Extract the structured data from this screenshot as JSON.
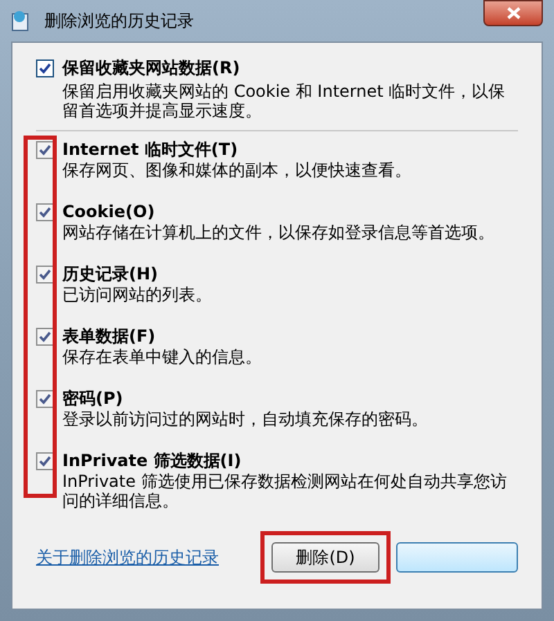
{
  "window": {
    "title": "删除浏览的历史记录"
  },
  "preserve_favorites": {
    "label": "保留收藏夹网站数据(R)",
    "checked": true,
    "description": "保留启用收藏夹网站的 Cookie 和 Internet 临时文件，以保留首选项并提高显示速度。"
  },
  "items": [
    {
      "label": "Internet 临时文件(T)",
      "checked": true,
      "description": "保存网页、图像和媒体的副本，以便快速查看。"
    },
    {
      "label": "Cookie(O)",
      "checked": true,
      "description": "网站存储在计算机上的文件，以保存如登录信息等首选项。"
    },
    {
      "label": "历史记录(H)",
      "checked": true,
      "description": "已访问网站的列表。"
    },
    {
      "label": "表单数据(F)",
      "checked": true,
      "description": "保存在表单中键入的信息。"
    },
    {
      "label": "密码(P)",
      "checked": true,
      "description": "登录以前访问过的网站时，自动填充保存的密码。"
    },
    {
      "label": "InPrivate 筛选数据(I)",
      "checked": true,
      "description": "InPrivate 筛选使用已保存数据检测网站在何处自动共享您访问的详细信息。"
    }
  ],
  "footer": {
    "link": "关于删除浏览的历史记录",
    "delete_button": "删除(D)"
  },
  "checkbox_column_highlight": {
    "color": "#cc1f1f"
  },
  "delete_button_highlight": {
    "color": "#cc1f1f"
  }
}
